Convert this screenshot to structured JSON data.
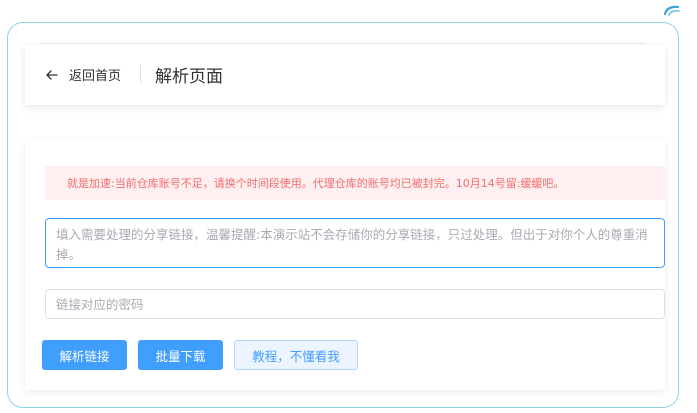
{
  "header": {
    "back_label": "返回首页",
    "title": "解析页面"
  },
  "alert": {
    "text": "就是加速:当前仓库账号不足，请换个时间段使用。代理仓库的账号均已被封完。10月14号留:缓缓吧。"
  },
  "form": {
    "link_placeholder": "填入需要处理的分享链接，温馨提醒:本演示站不会存储你的分享链接，只过处理。但出于对你个人的尊重消掉。",
    "password_placeholder": "链接对应的密码"
  },
  "buttons": {
    "parse": "解析链接",
    "batch_download": "批量下载",
    "tutorial": "教程，不懂看我"
  },
  "colors": {
    "primary": "#409eff",
    "alert_bg": "#fef0f0",
    "alert_text": "#f56c6c",
    "frame_border": "#8ed4e8"
  }
}
